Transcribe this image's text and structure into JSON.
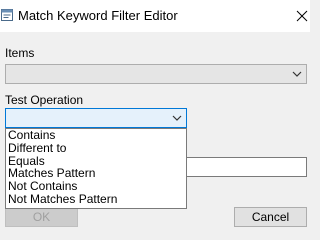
{
  "window": {
    "title": "Match Keyword Filter Editor",
    "icon": "editor-app-icon",
    "close_icon": "close-icon"
  },
  "items": {
    "label": "Items",
    "value": ""
  },
  "test_operation": {
    "label": "Test Operation",
    "value": "",
    "options": [
      "Contains",
      "Different to",
      "Equals",
      "Matches Pattern",
      "Not Contains",
      "Not Matches Pattern"
    ]
  },
  "value_field": {
    "value": ""
  },
  "buttons": {
    "ok": "OK",
    "cancel": "Cancel"
  },
  "colors": {
    "accent": "#0078d7",
    "window_bg": "#f0f0f0"
  }
}
